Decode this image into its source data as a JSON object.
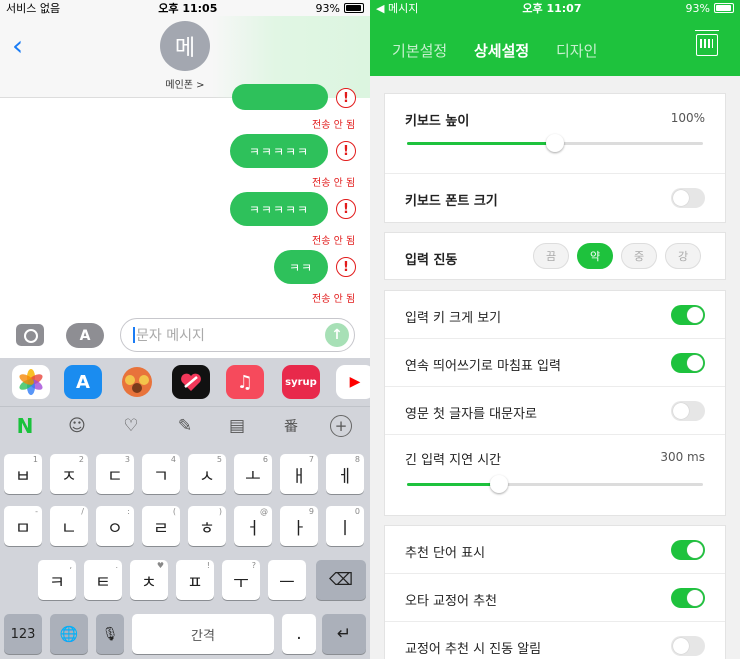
{
  "left": {
    "status": {
      "carrier": "서비스 없음",
      "time": "오후 11:05",
      "battery": "93%"
    },
    "contact": {
      "avatar_letter": "메",
      "name": "메인폰 >"
    },
    "messages": [
      {
        "text": "",
        "status": "전송 안 됨"
      },
      {
        "text": "ㅋㅋㅋㅋㅋ",
        "status": "전송 안 됨"
      },
      {
        "text": "ㅋㅋㅋㅋㅋ",
        "status": "전송 안 됨"
      },
      {
        "text": "ㅋㅋ",
        "status": "전송 안 됨"
      }
    ],
    "error_icon": "!",
    "input": {
      "placeholder": "문자 메시지",
      "apps_label": "A",
      "send_icon": "↑"
    },
    "app_strip": [
      "photos-icon",
      "app-store-icon",
      "memoji-icon",
      "digital-touch-icon",
      "music-icon",
      "syrup-icon",
      "youtube-icon"
    ],
    "app_strip_labels": {
      "music": "♫",
      "syrup": "syrup",
      "youtube": "▶"
    },
    "toolbar": {
      "n_logo": "N",
      "emoji": "☺",
      "heart": "♡",
      "pen": "✎",
      "memo": "▤",
      "translate": "番",
      "add": "+"
    },
    "keyboard": {
      "row1": [
        {
          "k": "ㅂ",
          "s": "1"
        },
        {
          "k": "ㅈ",
          "s": "2"
        },
        {
          "k": "ㄷ",
          "s": "3"
        },
        {
          "k": "ㄱ",
          "s": "4"
        },
        {
          "k": "ㅅ",
          "s": "5"
        },
        {
          "k": "ㅗ",
          "s": "6"
        },
        {
          "k": "ㅐ",
          "s": "7"
        },
        {
          "k": "ㅔ",
          "s": "8"
        }
      ],
      "row2": [
        {
          "k": "ㅁ",
          "s": "-"
        },
        {
          "k": "ㄴ",
          "s": "/"
        },
        {
          "k": "ㅇ",
          "s": ":"
        },
        {
          "k": "ㄹ",
          "s": "("
        },
        {
          "k": "ㅎ",
          "s": ")"
        },
        {
          "k": "ㅓ",
          "s": "@"
        },
        {
          "k": "ㅏ",
          "s": "9"
        },
        {
          "k": "ㅣ",
          "s": "0"
        }
      ],
      "row3": [
        {
          "k": "ㅋ",
          "s": ","
        },
        {
          "k": "ㅌ",
          "s": "."
        },
        {
          "k": "ㅊ",
          "s": "♥"
        },
        {
          "k": "ㅍ",
          "s": "!"
        },
        {
          "k": "ㅜ",
          "s": "?"
        },
        {
          "k": "ㅡ",
          "s": ""
        }
      ],
      "backspace": "⌫",
      "num": "123",
      "globe": "🌐",
      "mic": "🎙",
      "space": "간격",
      "period": ".",
      "return": "↵"
    }
  },
  "right": {
    "status": {
      "carrier": "◀ 메시지",
      "time": "오후 11:07",
      "battery": "93%"
    },
    "tabs": [
      {
        "label": "기본설정",
        "active": false
      },
      {
        "label": "상세설정",
        "active": true
      },
      {
        "label": "디자인",
        "active": false
      }
    ],
    "settings": {
      "keyboard_height": {
        "label": "키보드 높이",
        "value": "100%",
        "fraction": 0.5
      },
      "font_size": {
        "label": "키보드 폰트 크기",
        "on": false
      },
      "vibration": {
        "label": "입력 진동",
        "options": [
          "끔",
          "약",
          "중",
          "강"
        ],
        "selected": 1
      },
      "large_key": {
        "label": "입력 키 크게 보기",
        "on": true
      },
      "double_space": {
        "label": "연속 띄어쓰기로 마침표 입력",
        "on": true
      },
      "auto_cap": {
        "label": "영문 첫 글자를 대문자로",
        "on": false
      },
      "long_press": {
        "label": "긴 입력 지연 시간",
        "value": "300 ms",
        "fraction": 0.31
      },
      "suggestions": {
        "label": "추천 단어 표시",
        "on": true
      },
      "autocorrect": {
        "label": "오타 교정어 추천",
        "on": true
      },
      "correct_vibration": {
        "label": "교정어 추천 시 진동 알림",
        "on": false
      }
    }
  },
  "colors": {
    "green": "#1ec23d",
    "bubble": "#2ec15b",
    "error": "#e21b1b",
    "ios_blue": "#1a7cf5"
  }
}
